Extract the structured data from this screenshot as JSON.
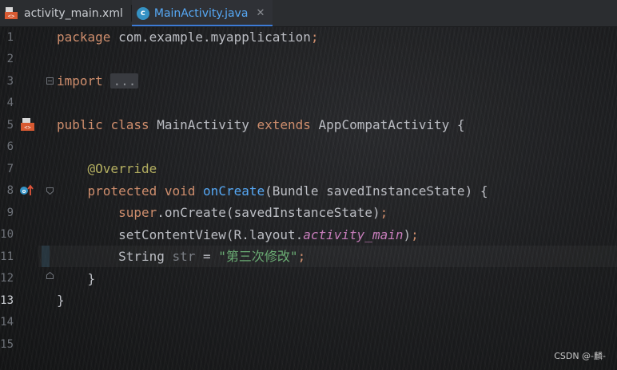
{
  "tabs": [
    {
      "label": "activity_main.xml",
      "icon": "xml-layout-icon",
      "active": false
    },
    {
      "label": "MainActivity.java",
      "icon": "java-class-icon",
      "active": true,
      "close": "✕"
    }
  ],
  "gutter": [
    "1",
    "2",
    "3",
    "4",
    "5",
    "6",
    "7",
    "8",
    "9",
    "10",
    "11",
    "12",
    "13",
    "14",
    "15"
  ],
  "code": {
    "l1_kw": "package",
    "l1_rest": " com.example.myapplication",
    "l1_semi": ";",
    "l3_kw": "import",
    "l3_collapsed": "...",
    "l7_kw1": "public",
    "l7_kw2": "class",
    "l7_name": " MainActivity ",
    "l7_kw3": "extends",
    "l7_rest": " AppCompatActivity {",
    "l9_ann": "@Override",
    "l10_kw1": "protected",
    "l10_kw2": "void",
    "l10_fn": "onCreate",
    "l10_rest": "(Bundle savedInstanceState) {",
    "l11_kw": "super",
    "l11_rest": ".onCreate(savedInstanceState)",
    "l11_semi": ";",
    "l12_a": "setContentView(R.layout.",
    "l12_fld": "activity_main",
    "l12_b": ")",
    "l12_semi": ";",
    "l13_type": "String",
    "l13_var": " str",
    "l13_eq": " = ",
    "l13_str": "\"第三次修改\"",
    "l13_semi": ";",
    "l14": "}",
    "l15": "}"
  },
  "watermark": "CSDN @-麟-",
  "colors": {
    "keyword": "#cf8e6d",
    "annotation": "#b3ae60",
    "function": "#56a8f5",
    "string": "#6aab73",
    "field": "#c77dbb"
  }
}
